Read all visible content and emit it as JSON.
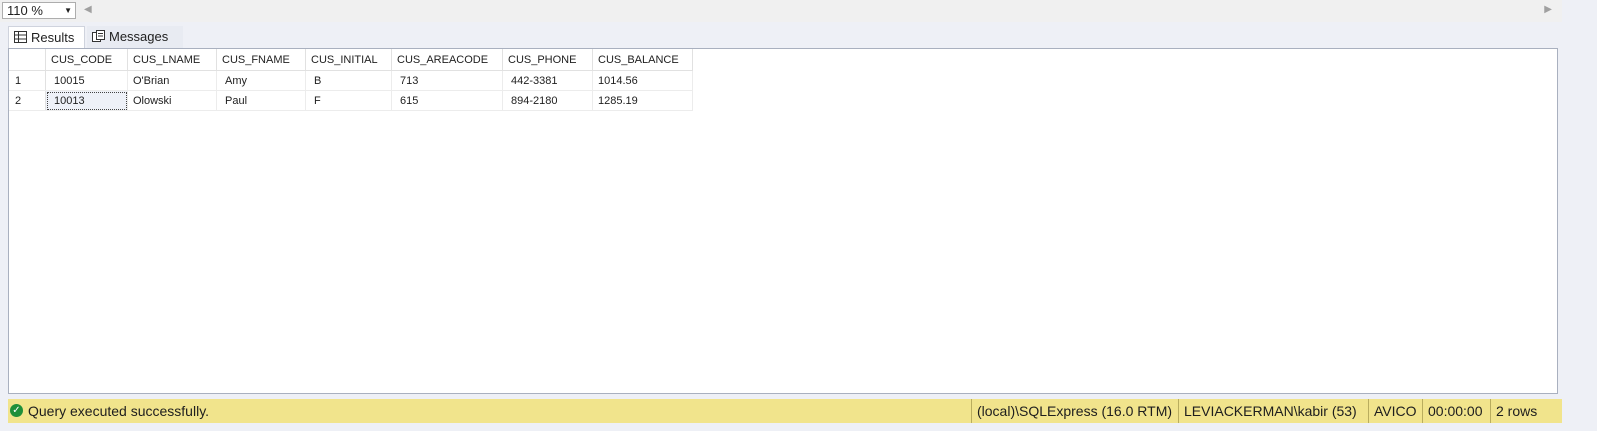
{
  "zoom": {
    "value": "110 %"
  },
  "tabs": [
    {
      "label": "Results",
      "icon": "grid-icon",
      "active": true
    },
    {
      "label": "Messages",
      "icon": "messages-icon",
      "active": false
    }
  ],
  "grid": {
    "columns": [
      "CUS_CODE",
      "CUS_LNAME",
      "CUS_FNAME",
      "CUS_INITIAL",
      "CUS_AREACODE",
      "CUS_PHONE",
      "CUS_BALANCE"
    ],
    "rows": [
      {
        "num": "1",
        "cells": [
          "10015",
          "O'Brian",
          "Amy",
          "B",
          "713",
          "442-3381",
          "1014.56"
        ]
      },
      {
        "num": "2",
        "cells": [
          "10013",
          "Olowski",
          "Paul",
          "F",
          "615",
          "894-2180",
          "1285.19"
        ]
      }
    ]
  },
  "status": {
    "message": "Query executed successfully.",
    "server": "(local)\\SQLExpress (16.0 RTM)",
    "user": "LEVIACKERMAN\\kabir (53)",
    "database": "AVICO",
    "elapsed": "00:00:00",
    "rows": "2 rows",
    "bar_color": "#f1e48c",
    "ok_color": "#1e8f3a"
  }
}
